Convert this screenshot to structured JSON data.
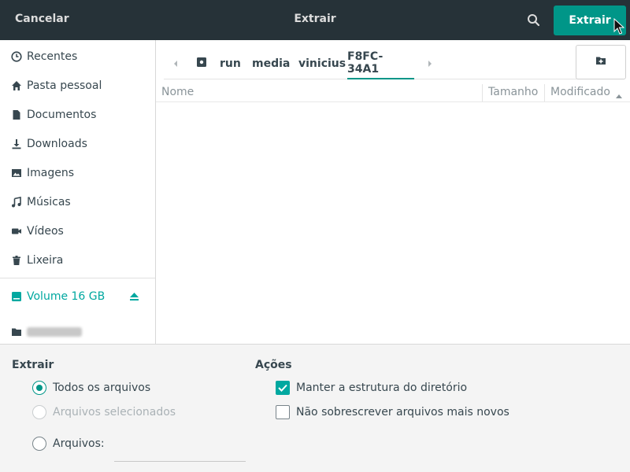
{
  "header": {
    "cancel_label": "Cancelar",
    "title": "Extrair",
    "search_icon": "search-icon",
    "extract_label": "Extrair",
    "accent_color": "#009688"
  },
  "sidebar": {
    "items": [
      {
        "label": "Recentes",
        "icon": "clock-icon"
      },
      {
        "label": "Pasta pessoal",
        "icon": "home-icon"
      },
      {
        "label": "Documentos",
        "icon": "document-icon"
      },
      {
        "label": "Downloads",
        "icon": "download-icon"
      },
      {
        "label": "Imagens",
        "icon": "image-icon"
      },
      {
        "label": "Músicas",
        "icon": "music-icon"
      },
      {
        "label": "Vídeos",
        "icon": "video-icon"
      },
      {
        "label": "Lixeira",
        "icon": "trash-icon"
      }
    ],
    "volume": {
      "label": "Volume 16 GB",
      "icon": "drive-icon",
      "action_icon": "eject-icon"
    },
    "folder_icon": "folder-icon"
  },
  "pathbar": {
    "root_icon": "drive-icon",
    "segments": [
      "run",
      "media",
      "vinicius",
      "F8FC-34A1"
    ],
    "active_index": 3
  },
  "new_folder_icon": "new-folder-icon",
  "columns": {
    "name": "Nome",
    "size": "Tamanho",
    "modified": "Modificado",
    "sort_icon": "sort-ascending-icon"
  },
  "extract_options": {
    "title": "Extrair",
    "all_files": "Todos os arquivos",
    "selected_files": "Arquivos selecionados",
    "files": "Arquivos:",
    "selected": "all_files"
  },
  "actions": {
    "title": "Ações",
    "keep_structure": "Manter a estrutura do diretório",
    "keep_structure_checked": true,
    "no_overwrite": "Não sobrescrever arquivos mais novos",
    "no_overwrite_checked": false
  }
}
